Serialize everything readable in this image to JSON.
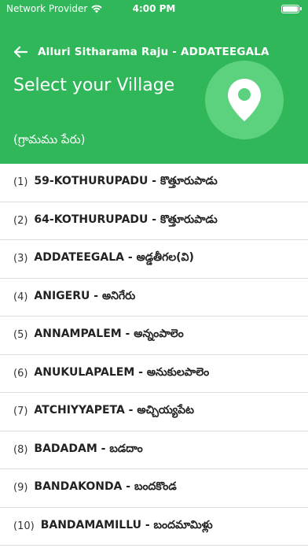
{
  "status_bar": {
    "carrier": "Network Provider",
    "time": "4:00 PM",
    "battery_level": 1.0
  },
  "header": {
    "nav_title": "Alluri Sitharama Raju  - ADDATEEGALA",
    "title": "Select your Village",
    "subtitle": "(గ్రామము పేరు)"
  },
  "villages": [
    {
      "num": "(1)",
      "name": "59-KOTHURUPADU - కొత్తూరుపాడు"
    },
    {
      "num": "(2)",
      "name": "64-KOTHURUPADU - కొత్తూరుపాడు"
    },
    {
      "num": "(3)",
      "name": "ADDATEEGALA - అడ్డతీగల(వి)"
    },
    {
      "num": "(4)",
      "name": "ANIGERU - అనిగేరు"
    },
    {
      "num": "(5)",
      "name": "ANNAMPALEM - అన్నంపాలెం"
    },
    {
      "num": "(6)",
      "name": "ANUKULAPALEM - అనుకులపాలెం"
    },
    {
      "num": "(7)",
      "name": "ATCHIYYAPETA - అచ్చియ్యపేట"
    },
    {
      "num": "(8)",
      "name": "BADADAM - బడదాం"
    },
    {
      "num": "(9)",
      "name": "BANDAKONDA - బందకొండ"
    },
    {
      "num": "(10)",
      "name": "BANDAMAMILLU - బందమామిళ్లు"
    }
  ],
  "colors": {
    "primary": "#2fb75a",
    "pin_circle": "#5cd27f",
    "divider": "#dcdcdc"
  },
  "icons": {
    "back": "arrow-left-icon",
    "pin": "location-pin-icon",
    "wifi": "wifi-icon",
    "battery": "battery-icon"
  }
}
